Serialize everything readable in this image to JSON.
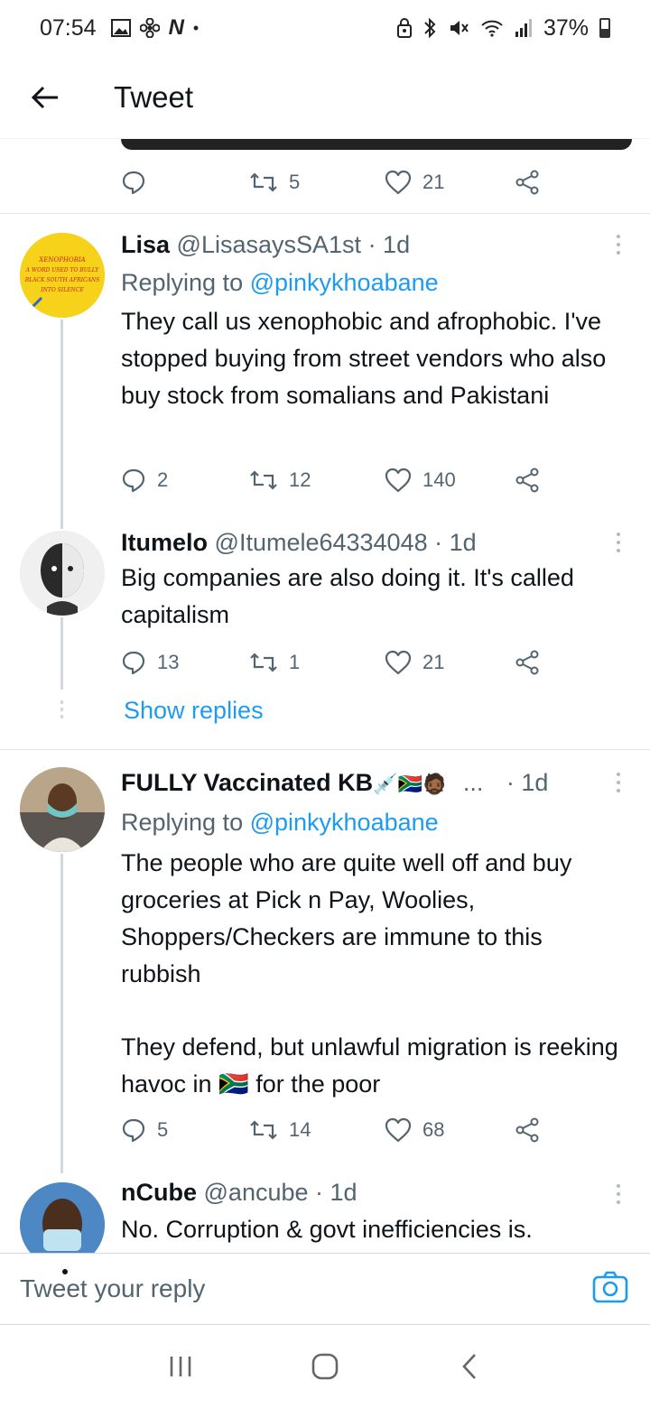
{
  "status": {
    "time": "07:54",
    "notification_icons": [
      "image-icon",
      "fan-icon",
      "netflix-icon",
      "dot-icon"
    ],
    "battery": "37%",
    "system_icons": [
      "lock-icon",
      "bluetooth-icon",
      "mute-icon",
      "wifi-icon",
      "signal-icon"
    ]
  },
  "header": {
    "title": "Tweet"
  },
  "top_actions": {
    "reply_count": "",
    "retweet_count": "5",
    "like_count": "21"
  },
  "tweets": [
    {
      "name": "Lisa",
      "handle": "@LisasaysSA1st",
      "time": "· 1d",
      "replying_prefix": "Replying to ",
      "replying_to": "@pinkykhoabane",
      "text": "They call us xenophobic and afrophobic. I've stopped buying from street vendors who also buy stock from somalians and Pakistani",
      "replies": "2",
      "retweets": "12",
      "likes": "140",
      "avatar_text": "XENOPHOBIA\nA WORD USED TO BULLY\nBLACK SOUTH AFRICANS\nINTO SILENCE",
      "avatar_color": "#f6d21b"
    },
    {
      "name": "Itumelo",
      "handle": "@Itumele64334048",
      "time": "· 1d",
      "text": "Big companies are also doing it. It's called capitalism",
      "replies": "13",
      "retweets": "1",
      "likes": "21",
      "show_replies": "Show replies"
    },
    {
      "name": "FULLY Vaccinated KB",
      "name_suffix": "💉🇿🇦🧔🏾",
      "ellipsis": "...",
      "handle": "",
      "time": "· 1d",
      "replying_prefix": "Replying to ",
      "replying_to": "@pinkykhoabane",
      "text_1": "The people who are quite well off and buy groceries at Pick n Pay, Woolies, Shoppers/Checkers are immune to this rubbish",
      "text_2a": "They defend, but unlawful migration is reeking havoc in ",
      "flag": "🇿🇦",
      "text_2b": " for the poor",
      "replies": "5",
      "retweets": "14",
      "likes": "68"
    },
    {
      "name": "nCube",
      "handle": "@ancube",
      "time": "· 1d",
      "text": "No. Corruption & govt inefficiencies is."
    }
  ],
  "reply_bar": {
    "placeholder": "Tweet your reply"
  },
  "colors": {
    "accent": "#1d9bf0",
    "muted": "#536471",
    "text": "#0f1419"
  }
}
